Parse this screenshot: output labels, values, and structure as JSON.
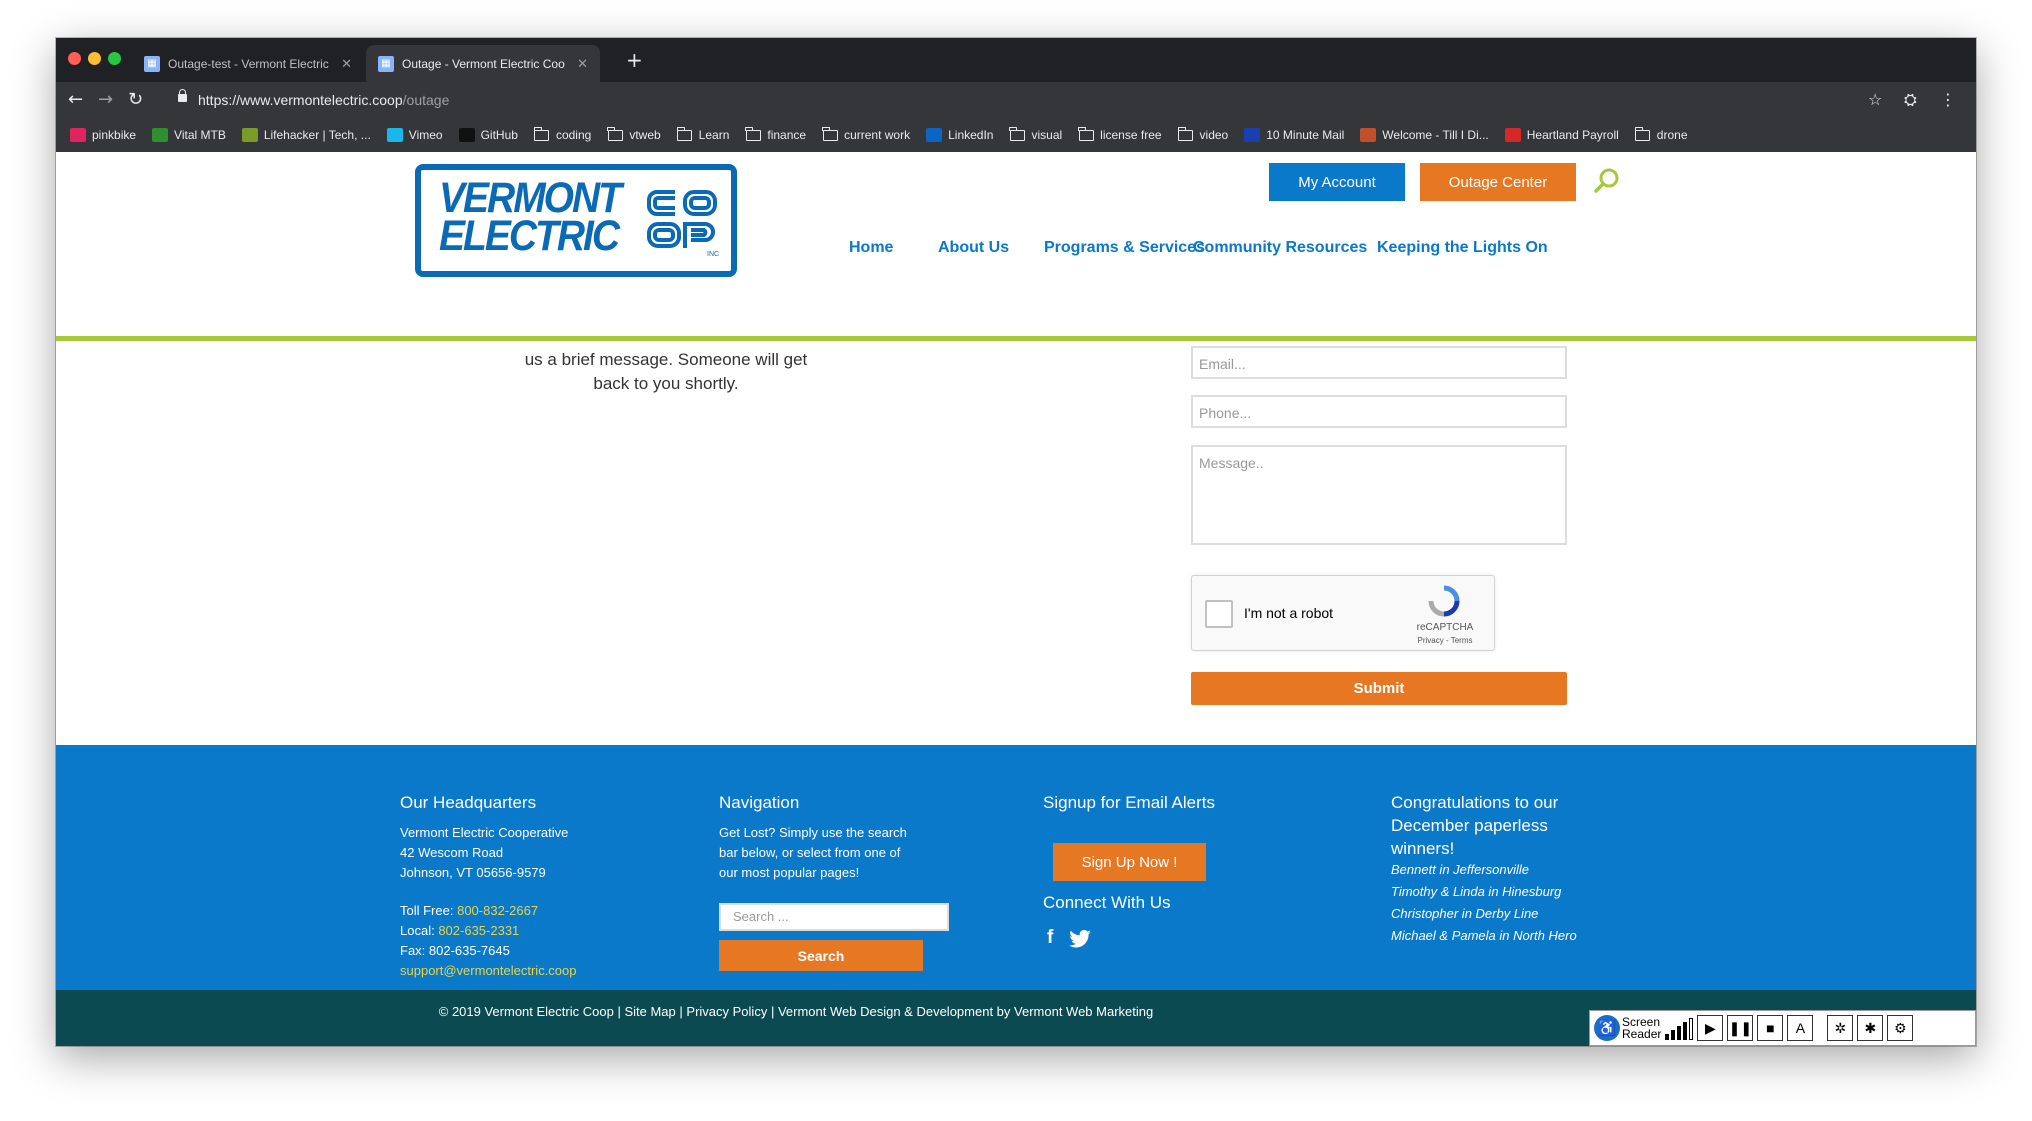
{
  "browser": {
    "tabs": [
      {
        "title": "Outage-test - Vermont Electric",
        "active": false
      },
      {
        "title": "Outage - Vermont Electric Coo",
        "active": true
      }
    ],
    "url_host": "https://www.vermontelectric.coop",
    "url_path": "/outage",
    "bookmarks": [
      {
        "label": "pinkbike",
        "icon": "pinkbike-icon",
        "color": "#e0245e"
      },
      {
        "label": "Vital MTB",
        "icon": "vital-icon",
        "color": "#2f8f2f"
      },
      {
        "label": "Lifehacker | Tech, ...",
        "icon": "lifehacker-icon",
        "color": "#7a9a2a"
      },
      {
        "label": "Vimeo",
        "icon": "vimeo-icon",
        "color": "#1ab7ea"
      },
      {
        "label": "GitHub",
        "icon": "github-icon",
        "color": "#111111"
      },
      {
        "label": "coding",
        "icon": "folder-icon"
      },
      {
        "label": "vtweb",
        "icon": "folder-icon"
      },
      {
        "label": "Learn",
        "icon": "folder-icon"
      },
      {
        "label": "finance",
        "icon": "folder-icon"
      },
      {
        "label": "current work",
        "icon": "folder-icon"
      },
      {
        "label": "LinkedIn",
        "icon": "linkedin-icon",
        "color": "#0a66c2"
      },
      {
        "label": "visual",
        "icon": "folder-icon"
      },
      {
        "label": "license free",
        "icon": "folder-icon"
      },
      {
        "label": "video",
        "icon": "folder-icon"
      },
      {
        "label": "10 Minute Mail",
        "icon": "tenminutemail-icon",
        "color": "#1a3fb0"
      },
      {
        "label": "Welcome - Till I Di...",
        "icon": "welcome-icon",
        "color": "#c0502a"
      },
      {
        "label": "Heartland Payroll",
        "icon": "heartland-icon",
        "color": "#d62828"
      },
      {
        "label": "drone",
        "icon": "folder-icon"
      }
    ]
  },
  "site": {
    "logo_line1": "VERMONT",
    "logo_line2": "ELECTRIC",
    "logo_coop": "CO OP",
    "logo_inc": "INC",
    "header_buttons": {
      "account": "My Account",
      "outage": "Outage Center"
    },
    "nav": [
      "Home",
      "About Us",
      "Programs & Services",
      "Community Resources",
      "Keeping the Lights On"
    ],
    "colors": {
      "brand_blue": "#0b79c9",
      "orange": "#e67823",
      "green": "#a7c83b",
      "dark_teal": "#0c4a52"
    }
  },
  "content": {
    "message_line1": "us a brief message. Someone will get",
    "message_line2": "back to you shortly.",
    "form": {
      "email_placeholder": "Email...",
      "phone_placeholder": "Phone...",
      "message_placeholder": "Message..",
      "recaptcha_label": "I'm not a robot",
      "recaptcha_brand": "reCAPTCHA",
      "recaptcha_terms": "Privacy - Terms",
      "submit": "Submit"
    }
  },
  "footer": {
    "hq": {
      "heading": "Our Headquarters",
      "name": "Vermont Electric Cooperative",
      "street": "42 Wescom Road",
      "city": "Johnson, VT 05656-9579",
      "tollfree_label": "Toll Free:",
      "tollfree": "800-832-2667",
      "local_label": "Local:",
      "local": "802-635-2331",
      "fax": "Fax: 802-635-7645",
      "email": "support@vermontelectric.coop"
    },
    "navigation": {
      "heading": "Navigation",
      "line1": "Get Lost? Simply use the search",
      "line2": "bar below, or select from one of",
      "line3": "our most popular pages!",
      "search_placeholder": "Search ...",
      "search_button": "Search"
    },
    "signup": {
      "heading": "Signup for Email Alerts",
      "button": "Sign Up Now !",
      "connect": "Connect With Us"
    },
    "winners": {
      "heading_line1": "Congratulations to our",
      "heading_line2": "December paperless",
      "heading_line3": "winners!",
      "names": [
        "Bennett in Jeffersonville",
        "Timothy & Linda in Hinesburg",
        "Christopher in Derby Line",
        "Michael & Pamela in North Hero"
      ]
    },
    "bottom": {
      "copyright": "© 2019 Vermont Electric Coop",
      "sitemap": "Site Map",
      "privacy": "Privacy Policy",
      "credit": "Vermont Web Design & Development by Vermont Web Marketing",
      "sep": "|"
    },
    "reader": {
      "line1": "Screen",
      "line2": "Reader"
    }
  }
}
